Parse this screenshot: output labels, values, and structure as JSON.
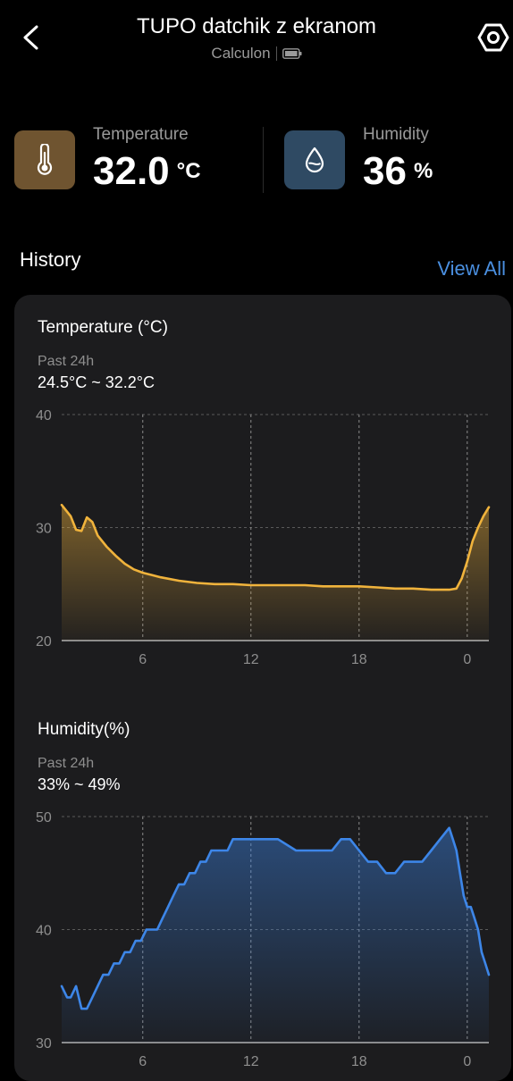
{
  "header": {
    "title": "TUPO datchik z ekranom",
    "device_name": "Calculon",
    "back_icon": "chevron-left-icon",
    "settings_icon": "hexagon-gear-icon",
    "battery_icon": "battery-full-icon"
  },
  "readings": {
    "temperature": {
      "label": "Temperature",
      "value": "32.0",
      "unit": "°C",
      "icon": "thermometer-icon",
      "color": "#6f5430"
    },
    "humidity": {
      "label": "Humidity",
      "value": "36",
      "unit": "%",
      "icon": "water-drop-icon",
      "color": "#2f4a63"
    }
  },
  "history": {
    "title": "History",
    "view_all": "View All",
    "accent": "#4a8fe0"
  },
  "charts": {
    "temperature": {
      "title": "Temperature (°C)",
      "period": "Past 24h",
      "range": "24.5°C ~ 32.2°C"
    },
    "humidity": {
      "title": "Humidity(%)",
      "period": "Past 24h",
      "range": "33% ~ 49%"
    }
  },
  "chart_data": [
    {
      "type": "area",
      "title": "Temperature (°C)",
      "line_color": "#f0b33c",
      "ylim": [
        20,
        40
      ],
      "y_ticks": [
        20,
        30,
        40
      ],
      "x_ticks": [
        {
          "x": 6,
          "label": "6"
        },
        {
          "x": 12,
          "label": "12"
        },
        {
          "x": 18,
          "label": "18"
        },
        {
          "x": 24,
          "label": "0"
        }
      ],
      "xlim": [
        1.5,
        25.2
      ],
      "x": [
        1.5,
        2.0,
        2.3,
        2.6,
        2.9,
        3.2,
        3.5,
        4.0,
        4.5,
        5.0,
        5.5,
        6.0,
        6.5,
        7.0,
        8.0,
        9.0,
        10.0,
        11.0,
        12.0,
        13.0,
        14.0,
        15.0,
        16.0,
        17.0,
        18.0,
        19.0,
        20.0,
        21.0,
        22.0,
        23.0,
        23.4,
        23.7,
        24.0,
        24.3,
        24.6,
        24.9,
        25.2
      ],
      "y": [
        32.0,
        31.0,
        29.8,
        29.7,
        30.9,
        30.5,
        29.3,
        28.3,
        27.5,
        26.8,
        26.3,
        26.0,
        25.8,
        25.6,
        25.3,
        25.1,
        25.0,
        25.0,
        24.9,
        24.9,
        24.9,
        24.9,
        24.8,
        24.8,
        24.8,
        24.7,
        24.6,
        24.6,
        24.5,
        24.5,
        24.6,
        25.5,
        27.0,
        28.8,
        30.0,
        31.0,
        31.8
      ]
    },
    {
      "type": "area",
      "title": "Humidity(%)",
      "line_color": "#3d86e8",
      "ylim": [
        30,
        50
      ],
      "y_ticks": [
        30,
        40,
        50
      ],
      "x_ticks": [
        {
          "x": 6,
          "label": "6"
        },
        {
          "x": 12,
          "label": "12"
        },
        {
          "x": 18,
          "label": "18"
        },
        {
          "x": 24,
          "label": "0"
        }
      ],
      "xlim": [
        1.5,
        25.2
      ],
      "x": [
        1.5,
        1.8,
        2.0,
        2.3,
        2.6,
        2.9,
        3.2,
        3.5,
        3.8,
        4.1,
        4.4,
        4.7,
        5.0,
        5.3,
        5.6,
        5.9,
        6.2,
        6.5,
        6.8,
        7.1,
        7.4,
        7.7,
        8.0,
        8.3,
        8.6,
        8.9,
        9.2,
        9.5,
        9.8,
        10.1,
        10.4,
        10.7,
        11.0,
        11.3,
        11.6,
        11.9,
        12.5,
        13.5,
        14.5,
        15.5,
        16.5,
        17.0,
        17.5,
        18.0,
        18.5,
        19.0,
        19.5,
        20.0,
        20.5,
        21.0,
        21.5,
        22.0,
        22.5,
        23.0,
        23.2,
        23.4,
        23.6,
        23.8,
        24.0,
        24.2,
        24.4,
        24.6,
        24.8,
        25.0,
        25.2
      ],
      "y": [
        35,
        34,
        34,
        35,
        33,
        33,
        34,
        35,
        36,
        36,
        37,
        37,
        38,
        38,
        39,
        39,
        40,
        40,
        40,
        41,
        42,
        43,
        44,
        44,
        45,
        45,
        46,
        46,
        47,
        47,
        47,
        47,
        48,
        48,
        48,
        48,
        48,
        48,
        47,
        47,
        47,
        48,
        48,
        47,
        46,
        46,
        45,
        45,
        46,
        46,
        46,
        47,
        48,
        49,
        48,
        47,
        45,
        43,
        42,
        42,
        41,
        40,
        38,
        37,
        36
      ]
    }
  ]
}
